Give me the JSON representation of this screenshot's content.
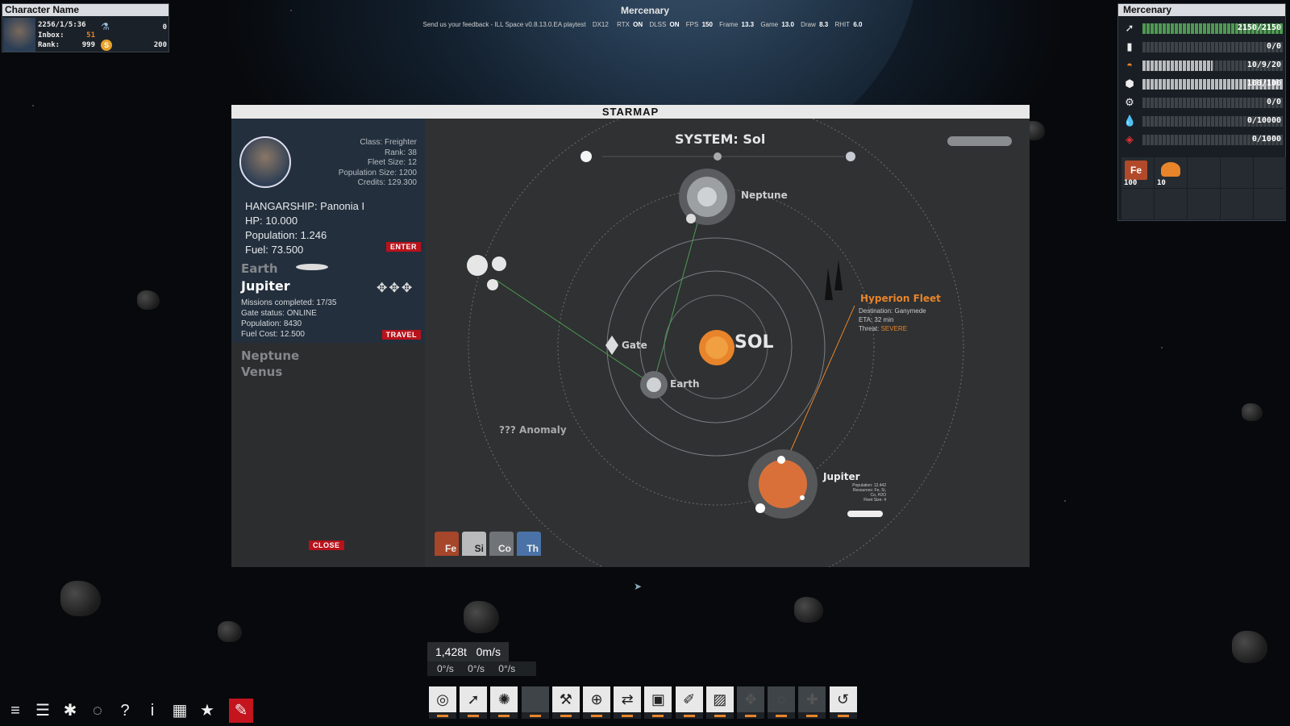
{
  "top_left": {
    "title": "Character Name",
    "date": "2256/1/5:36",
    "inbox_label": "Inbox:",
    "inbox": "51",
    "rank_label": "Rank:",
    "rank": "999",
    "flask": "0",
    "coins": "200"
  },
  "top_center": {
    "title": "Mercenary",
    "feedback": "Send us your feedback - ILL Space v0.8.13.0.EA playtest",
    "stats": [
      {
        "k": "DX12",
        "v": ""
      },
      {
        "k": "RTX",
        "v": "ON"
      },
      {
        "k": "DLSS",
        "v": "ON"
      },
      {
        "k": "FPS",
        "v": "150"
      },
      {
        "k": "Frame",
        "v": "13.3"
      },
      {
        "k": "Game",
        "v": "13.0"
      },
      {
        "k": "Draw",
        "v": "8.3"
      },
      {
        "k": "RHIT",
        "v": "6.0"
      }
    ]
  },
  "top_right": {
    "title": "Mercenary",
    "stats": [
      {
        "icon": "thruster-icon",
        "value": "2150/2150",
        "fill": 1.0
      },
      {
        "icon": "battery-icon",
        "value": "0/0",
        "fill": 0.0
      },
      {
        "icon": "crew-icon",
        "value": "10/9/20",
        "fill": 0.5
      },
      {
        "icon": "hull-icon",
        "value": "100/100",
        "fill": 1.0
      },
      {
        "icon": "gear-icon",
        "value": "0/0",
        "fill": 0.0
      },
      {
        "icon": "water-icon",
        "value": "0/10000",
        "fill": 0.0
      },
      {
        "icon": "hazard-icon",
        "value": "0/1000",
        "fill": 0.0
      }
    ],
    "inventory": [
      {
        "label": "Fe",
        "count": "100"
      },
      {
        "label": "",
        "count": "10"
      }
    ]
  },
  "starmap": {
    "title": "STARMAP",
    "class": "Class: Freighter",
    "rank": "Rank: 38",
    "fleet": "Fleet Size: 12",
    "pop": "Population Size: 1200",
    "credits": "Credits: 129.300",
    "hangar": "HANGARSHIP: Panonia I",
    "hp": "HP: 10.000",
    "population": "Population: 1.246",
    "fuel": "Fuel: 73.500",
    "enter": "ENTER",
    "destinations": {
      "earth": "Earth",
      "jupiter": "Jupiter",
      "neptune": "Neptune",
      "venus": "Venus"
    },
    "jupiter_info": {
      "missions": "Missions completed: 17/35",
      "gate": "Gate status: ONLINE",
      "population": "Population: 8430",
      "fuel": "Fuel Cost: 12.500"
    },
    "travel": "TRAVEL",
    "close": "CLOSE",
    "system": "SYSTEM: Sol",
    "sun": "SOL",
    "labels": {
      "neptune": "Neptune",
      "earth": "Earth",
      "gate": "Gate",
      "jupiter": "Jupiter",
      "anomaly": "??? Anomaly",
      "fleet": "Hyperion Fleet",
      "dest": "Destination: Ganymede",
      "eta": "ETA: 32 min",
      "threat_label": "Threat:",
      "threat": "SEVERE",
      "jup_pop": "Population: 12.442",
      "jup_res": "Resources: Fe, Si, Co, H2O",
      "jup_fleet": "Fleet Size: 4"
    },
    "resources": [
      "Fe",
      "Si",
      "Co",
      "Th"
    ]
  },
  "speed": {
    "mass": "1,428t",
    "speed": "0m/s",
    "rot": "0°/s   0°/s   0°/s"
  }
}
